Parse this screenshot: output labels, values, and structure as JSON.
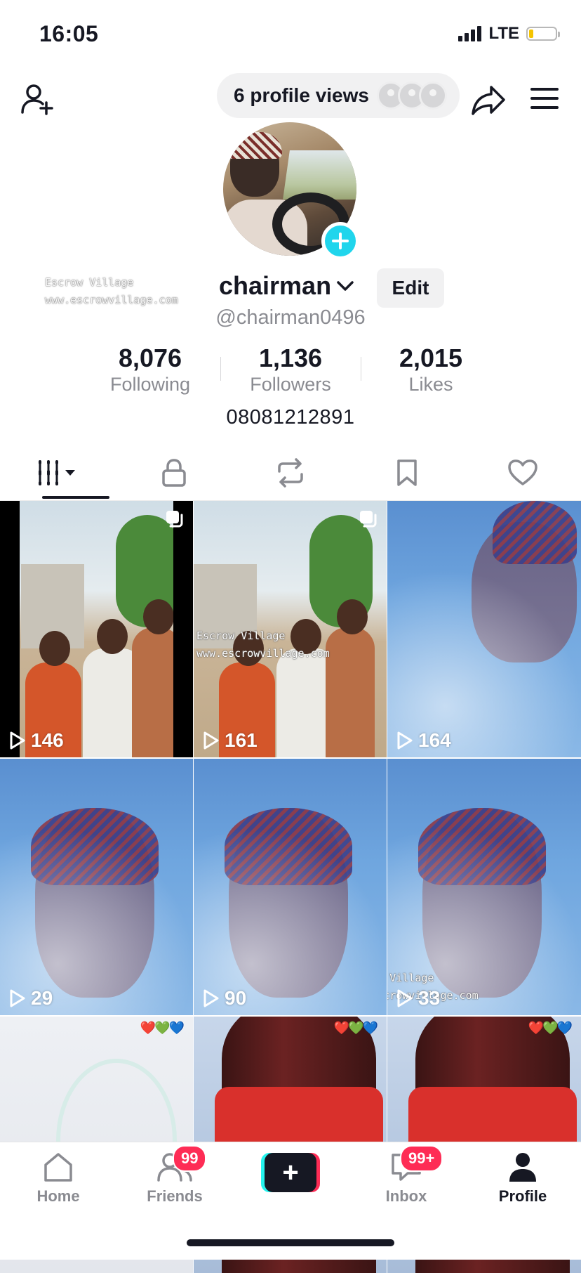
{
  "status_bar": {
    "time": "16:05",
    "network": "LTE"
  },
  "header": {
    "profile_views": "6 profile views"
  },
  "profile": {
    "name": "chairman",
    "handle": "@chairman0496",
    "edit_label": "Edit",
    "bio": "08081212891",
    "watermark_line1": "Escrow Village",
    "watermark_line2": "www.escrowvillage.com"
  },
  "stats": [
    {
      "value": "8,076",
      "label": "Following"
    },
    {
      "value": "1,136",
      "label": "Followers"
    },
    {
      "value": "2,015",
      "label": "Likes"
    }
  ],
  "tabs": [
    "videos-tab",
    "private-tab",
    "reposts-tab",
    "favorites-tab",
    "liked-tab"
  ],
  "videos": [
    {
      "views": "146",
      "thumb": "group-photo",
      "multi": true
    },
    {
      "views": "161",
      "thumb": "group-photo",
      "multi": true
    },
    {
      "views": "164",
      "thumb": "blue-selfie",
      "multi": false
    },
    {
      "views": "29",
      "thumb": "blue-selfie",
      "multi": false
    },
    {
      "views": "90",
      "thumb": "blue-selfie",
      "multi": false
    },
    {
      "views": "33",
      "thumb": "blue-selfie",
      "multi": false
    },
    {
      "views": "",
      "thumb": "light",
      "emoji": "❤️💚💙"
    },
    {
      "views": "",
      "thumb": "coke-bottle",
      "emoji": "❤️💚💙"
    },
    {
      "views": "",
      "thumb": "coke-bottle",
      "emoji": "❤️💚💙"
    }
  ],
  "bottom_nav": {
    "home": "Home",
    "friends": "Friends",
    "friends_badge": "99",
    "inbox": "Inbox",
    "inbox_badge": "99+",
    "profile": "Profile",
    "create_symbol": "+"
  },
  "colors": {
    "accent": "#fe2c55",
    "cyan": "#25f4ee",
    "plus_blue": "#20d5ec",
    "text": "#161823",
    "muted": "#8a8b91"
  }
}
